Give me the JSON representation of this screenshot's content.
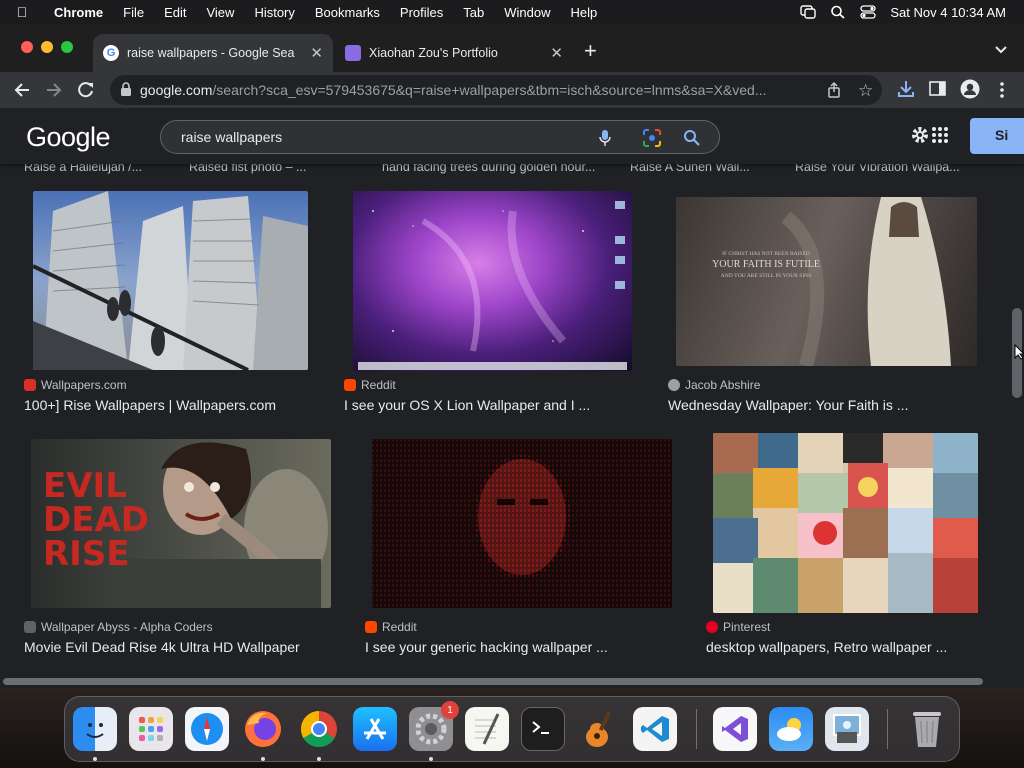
{
  "menubar": {
    "app_name": "Chrome",
    "items": [
      "File",
      "Edit",
      "View",
      "History",
      "Bookmarks",
      "Profiles",
      "Tab",
      "Window",
      "Help"
    ],
    "clock": "Sat Nov 4  10:34 AM"
  },
  "tabs": [
    {
      "title": "raise wallpapers - Google Sea",
      "favicon": "google-icon"
    },
    {
      "title": "Xiaohan Zou's Portfolio",
      "favicon": "portfolio-icon"
    }
  ],
  "address_bar": {
    "host": "google.com",
    "path": "/search?sca_esv=579453675&q=raise+wallpapers&tbm=isch&source=lnms&sa=X&ved..."
  },
  "google": {
    "logo": "Google",
    "query": "raise wallpapers",
    "sign_in": "Si"
  },
  "peek_captions": [
    "Raise a Hallelujah /...",
    "Raised fist photo – ...",
    "hand facing trees during golden hour...",
    "Raise A Sunen Wall...",
    "Raise Your Vibration Wallpa..."
  ],
  "results": [
    {
      "source": "Wallpapers.com",
      "title": "100+] Rise Wallpapers | Wallpapers.com",
      "color": "#d93025"
    },
    {
      "source": "Reddit",
      "title": "I see your OS X Lion Wallpaper and I ...",
      "color": "#ff4500"
    },
    {
      "source": "Jacob Abshire",
      "title": "Wednesday Wallpaper: Your Faith is ...",
      "color": "#9aa0a6",
      "image_text": [
        "IF CHRIST HAS NOT BEEN RAISED",
        "YOUR FAITH IS FUTILE",
        "AND YOU ARE STILL IN YOUR SINS"
      ]
    },
    {
      "source": "Wallpaper Abyss - Alpha Coders",
      "title": "Movie Evil Dead Rise 4k Ultra HD Wallpaper",
      "color": "#5f6368",
      "image_text": [
        "EVIL",
        "DEAD",
        "RISE"
      ]
    },
    {
      "source": "Reddit",
      "title": "I see your generic hacking wallpaper ...",
      "color": "#ff4500"
    },
    {
      "source": "Pinterest",
      "title": "desktop wallpapers, Retro wallpaper ...",
      "color": "#e60023"
    }
  ],
  "dock": {
    "apps": [
      "finder-icon",
      "launchpad-icon",
      "safari-icon",
      "firefox-icon",
      "chrome-icon",
      "app-store-icon",
      "system-settings-icon",
      "textedit-icon",
      "terminal-icon",
      "garageband-icon",
      "vscode-icon",
      "visual-studio-icon",
      "weather-icon",
      "preview-icon",
      "trash-icon"
    ],
    "settings_badge": "1"
  }
}
